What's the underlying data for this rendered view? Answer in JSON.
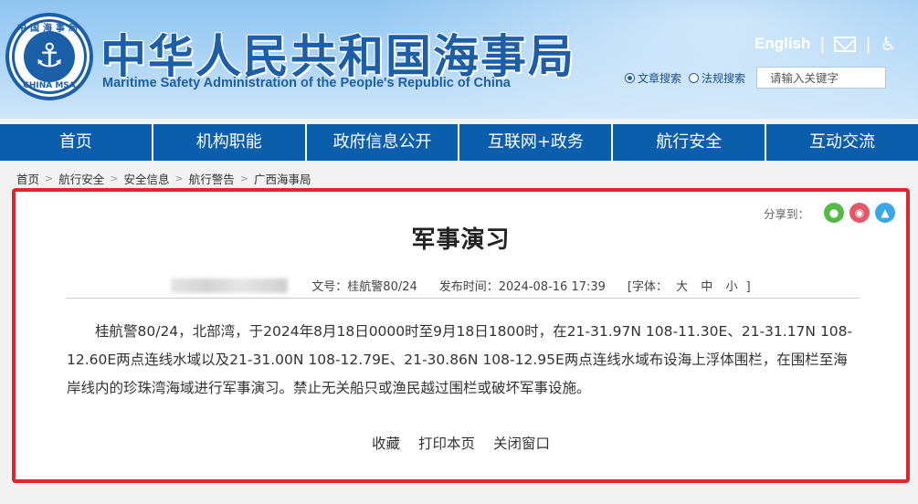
{
  "header": {
    "logo_top_text": "中国海事局",
    "logo_bottom_text": "CHINA MSA",
    "site_title": "中华人民共和国海事局",
    "site_subtitle": "Maritime Safety Administration of the People's Republic of China",
    "english_link": "English",
    "separator": "|",
    "search": {
      "options": [
        {
          "label": "文章搜索",
          "selected": true
        },
        {
          "label": "法规搜索",
          "selected": false
        }
      ],
      "placeholder": "请输入关键字"
    }
  },
  "nav": {
    "items": [
      "首页",
      "机构职能",
      "政府信息公开",
      "互联网+政务",
      "航行安全",
      "互动交流"
    ]
  },
  "breadcrumb": {
    "items": [
      "首页",
      "航行安全",
      "安全信息",
      "航行警告",
      "广西海事局"
    ],
    "separator": ">"
  },
  "share": {
    "label": "分享到：",
    "icons": [
      "wechat-icon",
      "weibo-icon",
      "qzone-icon"
    ],
    "colors": {
      "wechat": "#55b947",
      "weibo": "#e4566a",
      "qzone": "#39a7e8"
    }
  },
  "article": {
    "title": "军事演习",
    "doc_no": "文号：桂航警80/24",
    "publish_time": "发布时间：2024-08-16 17:39",
    "font_label_open": "[字体：",
    "font_large": "大",
    "font_medium": "中",
    "font_small": "小",
    "font_label_close": "]",
    "body": "桂航警80/24，北部湾，于2024年8月18日0000时至9月18日1800时，在21-31.97N 108-11.30E、21-31.17N 108-12.60E两点连线水域以及21-31.00N 108-12.79E、21-30.86N 108-12.95E两点连线水域布设海上浮体围栏，在围栏至海岸线内的珍珠湾海域进行军事演习。禁止无关船只或渔民越过围栏或破坏军事设施。",
    "actions": [
      "收藏",
      "打印本页",
      "关闭窗口"
    ]
  },
  "colors": {
    "nav_bg": "#0a5eab",
    "title_blue": "#1d5ea6",
    "highlight_border": "#e0262a"
  }
}
